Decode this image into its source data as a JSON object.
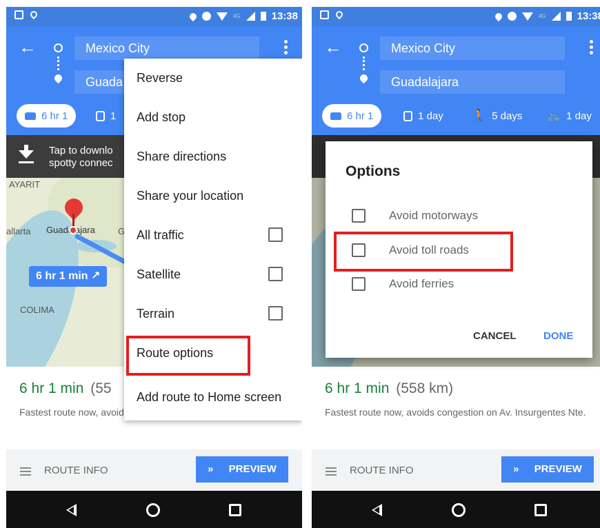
{
  "colors": {
    "primary": "#4285f4",
    "status_bar": "#3f7fe0",
    "duration_green": "#188038",
    "highlight_red": "#e02020"
  },
  "status_bar": {
    "time": "13:38",
    "network": "4G",
    "icons": [
      "image-icon",
      "pin-icon",
      "location-icon",
      "dnd-icon",
      "wifi-icon",
      "signal-icon",
      "battery-icon"
    ]
  },
  "directions": {
    "origin": "Mexico City",
    "destination": "Guadalajara",
    "origin_truncated": "Guada"
  },
  "travel_modes": [
    {
      "mode": "drive",
      "icon": "car-icon",
      "label": "6 hr 1"
    },
    {
      "mode": "transit",
      "icon": "bus-icon",
      "label": "1 day"
    },
    {
      "mode": "walk",
      "icon": "walk-icon",
      "label": "5 days"
    },
    {
      "mode": "bike",
      "icon": "bike-icon",
      "label": "1 day"
    }
  ],
  "travel_modes_left_transit_partial": "1",
  "banner": {
    "text": "Tap to downlo\nspotty connec"
  },
  "map": {
    "labels": [
      "AYARIT",
      "allarta",
      "Guadalajara",
      "G",
      "COLIMA"
    ],
    "route_chip": "6 hr 1 min ↗"
  },
  "summary": {
    "duration": "6 hr 1 min",
    "distance": "(558 km)",
    "distance_truncated": "(55",
    "description": "Fastest route now, avoids congestion on Av. Insurgentes Nte."
  },
  "bottom": {
    "route_info": "ROUTE INFO",
    "preview": "PREVIEW",
    "preview_arrows": "»"
  },
  "overflow_menu": {
    "items": [
      {
        "label": "Reverse",
        "checkbox": false,
        "checked": false
      },
      {
        "label": "Add stop",
        "checkbox": false,
        "checked": false
      },
      {
        "label": "Share directions",
        "checkbox": false,
        "checked": false
      },
      {
        "label": "Share your location",
        "checkbox": false,
        "checked": false
      },
      {
        "label": "All traffic",
        "checkbox": true,
        "checked": false
      },
      {
        "label": "Satellite",
        "checkbox": true,
        "checked": false
      },
      {
        "label": "Terrain",
        "checkbox": true,
        "checked": false
      },
      {
        "label": "Route options",
        "checkbox": false,
        "checked": false
      },
      {
        "label": "Add route to Home screen",
        "checkbox": false,
        "checked": false
      }
    ]
  },
  "options_dialog": {
    "title": "Options",
    "options": [
      {
        "label": "Avoid motorways",
        "checked": false
      },
      {
        "label": "Avoid toll roads",
        "checked": false
      },
      {
        "label": "Avoid ferries",
        "checked": false
      }
    ],
    "cancel": "CANCEL",
    "done": "DONE"
  }
}
